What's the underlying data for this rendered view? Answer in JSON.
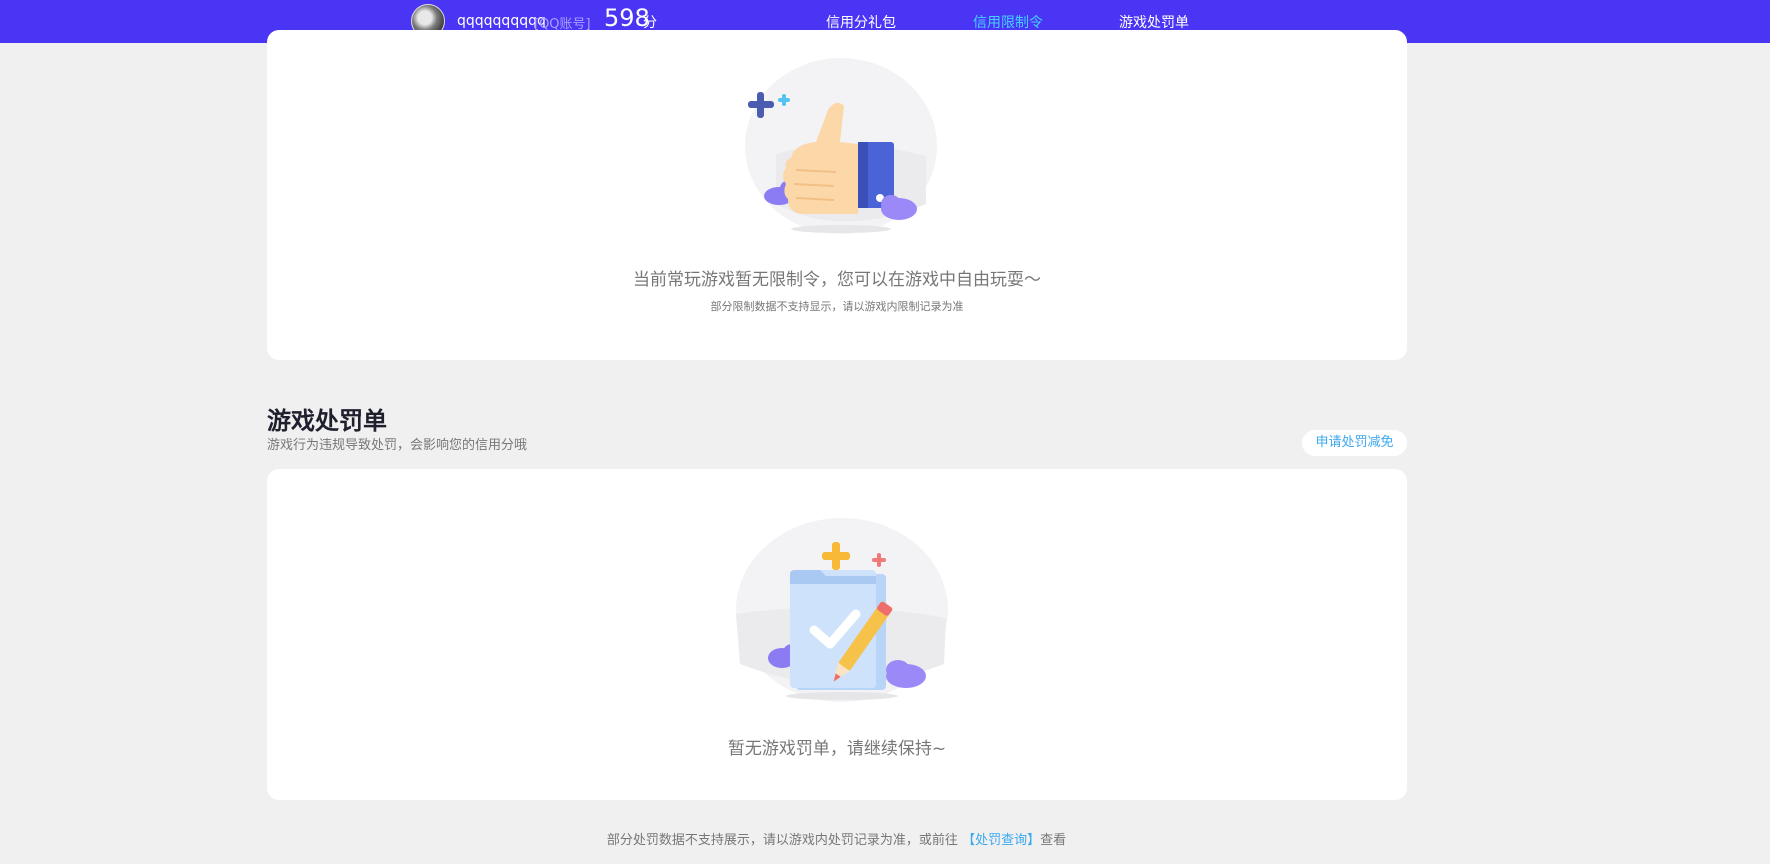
{
  "header": {
    "username": "qqqqqqqqqq",
    "account_type": "[QQ账号]",
    "score": "598",
    "score_unit": "分",
    "nav": [
      {
        "label": "信用分礼包",
        "active": false
      },
      {
        "label": "信用限制令",
        "active": true
      },
      {
        "label": "游戏处罚单",
        "active": false
      }
    ]
  },
  "restriction_card": {
    "message": "当前常玩游戏暂无限制令，您可以在游戏中自由玩耍～",
    "note": "部分限制数据不支持显示，请以游戏内限制记录为准"
  },
  "penalty_section": {
    "title": "游戏处罚单",
    "description": "游戏行为违规导致处罚，会影响您的信用分哦",
    "apply_button": "申请处罚减免",
    "empty_message": "暂无游戏罚单，请继续保持~"
  },
  "footer": {
    "prefix": "部分处罚数据不支持展示，请以游戏内处罚记录为准，或前往",
    "link": "【处罚查询】",
    "suffix": "查看"
  },
  "colors": {
    "topbar": "#4b35f5",
    "active_nav": "#43d2ff",
    "link": "#3aa8ee",
    "background": "#f0f0f0"
  }
}
